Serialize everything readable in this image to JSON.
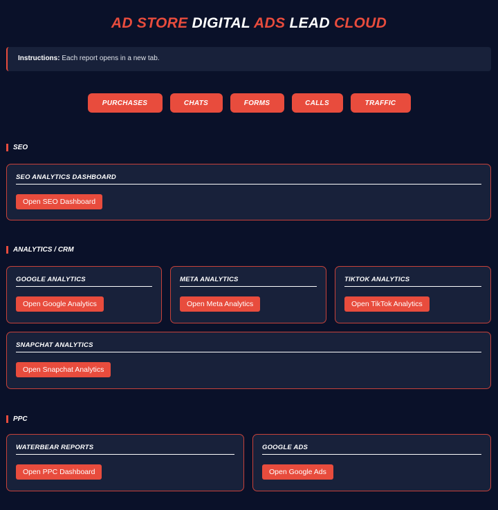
{
  "title": {
    "p1": "AD STORE",
    "p2": "DIGITAL",
    "p3": "ADS",
    "p4": "LEAD",
    "p5": "CLOUD"
  },
  "instructions": {
    "label": "Instructions:",
    "text": "Each report opens in a new tab."
  },
  "nav": [
    "PURCHASES",
    "CHATS",
    "FORMS",
    "CALLS",
    "TRAFFIC"
  ],
  "sections": {
    "seo": {
      "heading": "SEO",
      "cards": [
        {
          "title": "SEO ANALYTICS DASHBOARD",
          "button": "Open SEO Dashboard"
        }
      ]
    },
    "analytics": {
      "heading": "ANALYTICS / CRM",
      "cards": [
        {
          "title": "GOOGLE ANALYTICS",
          "button": "Open Google Analytics"
        },
        {
          "title": "META ANALYTICS",
          "button": "Open Meta Analytics"
        },
        {
          "title": "TIKTOK ANALYTICS",
          "button": "Open TikTok Analytics"
        },
        {
          "title": "SNAPCHAT ANALYTICS",
          "button": "Open Snapchat Analytics"
        }
      ]
    },
    "ppc": {
      "heading": "PPC",
      "cards": [
        {
          "title": "WATERBEAR REPORTS",
          "button": "Open PPC Dashboard"
        },
        {
          "title": "GOOGLE ADS",
          "button": "Open Google Ads"
        }
      ]
    }
  }
}
